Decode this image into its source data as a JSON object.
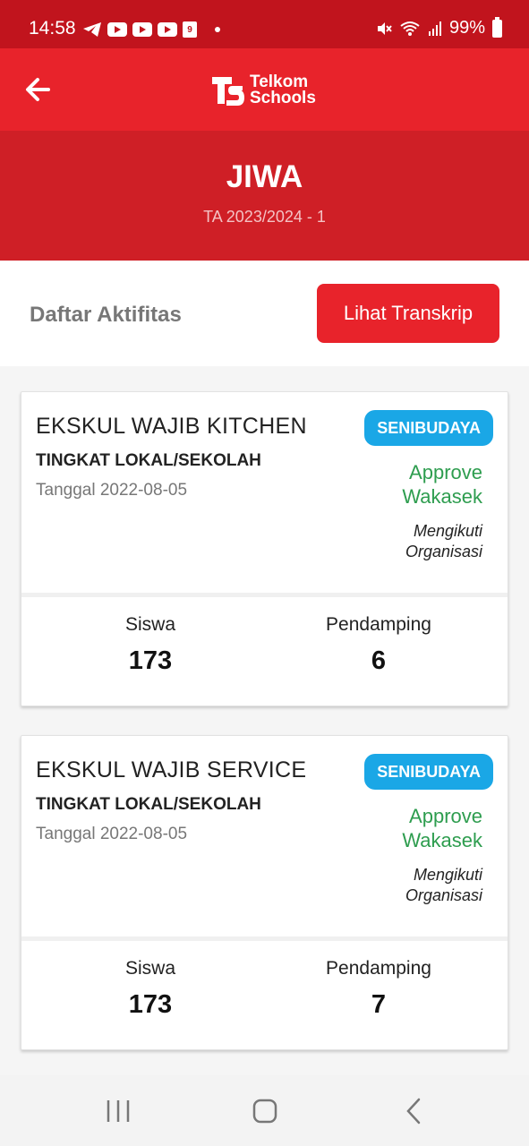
{
  "status_bar": {
    "time": "14:58",
    "calendar_day": "9",
    "battery": "99%",
    "icons": [
      "telegram-icon",
      "youtube-icon",
      "youtube-icon",
      "youtube-icon",
      "calendar-icon",
      "mute-icon",
      "wifi-icon",
      "signal-icon",
      "battery-icon"
    ]
  },
  "app_bar": {
    "logo_line1": "Telkom",
    "logo_line2": "Schools"
  },
  "hero": {
    "title": "JIWA",
    "subtitle": "TA 2023/2024 - 1"
  },
  "toolbar": {
    "title": "Daftar Aktifitas",
    "transcript_button": "Lihat Transkrip"
  },
  "activities": [
    {
      "name": "EKSKUL WAJIB KITCHEN",
      "level": "TINGKAT LOKAL/SEKOLAH",
      "date": "Tanggal 2022-08-05",
      "badge": "SENIBUDAYA",
      "status": "Approve Wakasek",
      "participation": "Mengikuti Organisasi",
      "students_label": "Siswa",
      "students": "173",
      "companions_label": "Pendamping",
      "companions": "6"
    },
    {
      "name": "EKSKUL WAJIB SERVICE",
      "level": "TINGKAT LOKAL/SEKOLAH",
      "date": "Tanggal 2022-08-05",
      "badge": "SENIBUDAYA",
      "status": "Approve Wakasek",
      "participation": "Mengikuti Organisasi",
      "students_label": "Siswa",
      "students": "173",
      "companions_label": "Pendamping",
      "companions": "7"
    }
  ],
  "colors": {
    "primary_red": "#e8232b",
    "dark_red": "#cf1f26",
    "status_red": "#c1141d",
    "badge_blue": "#1aa7e6",
    "approve_green": "#2e9d4f"
  }
}
